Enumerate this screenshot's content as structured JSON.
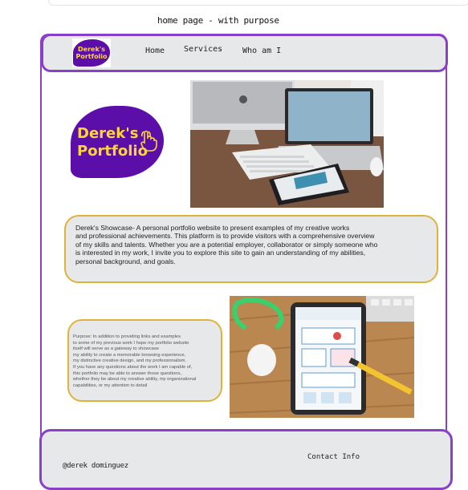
{
  "caption": "home page - with purpose",
  "nav": {
    "logo_text": "Derek's\nPortfolio",
    "links": [
      "Home",
      "Services",
      "Who am I"
    ]
  },
  "hero": {
    "logo_text": "Derek's\nPortfolio",
    "photo_icon": "desk-computers-image"
  },
  "showcase": {
    "text": "Derek's Showcase- A personal portfolio website to present examples of my creative works\nand professional achievements. This platform is to provide visitors with a comprehensive overview\nof my skills and talents.  Whether you are a potential employer, collaborator or simply someone who\n is interested in my work, I invite you to explore this site to gain an understanding of my abilities,\npersonal background, and goals."
  },
  "purpose": {
    "text": "Purpose: In addition to providing links and examples\n to some of my previous work I hope my portfolio website\nitself will serve as a gateway to showcase\n my ability to create a memorable browsing experience,\n my distinctive creative design, and my professionalism.\nIf you have any questions about the work I am capable of,\n this portfolio may be able to answer those questions,\nwhether they be about my creative ability, my organizational\ncapabilities, or my attention to detail",
    "photo_icon": "tablet-sketch-image"
  },
  "footer": {
    "name": "@derek dominguez",
    "contact": "Contact Info"
  },
  "colors": {
    "frame": "#8a3fc9",
    "logo_bg": "#5b0ea8",
    "logo_text": "#ffd43a",
    "box_border": "#dfb23a",
    "panel_bg": "#e6e8ea"
  }
}
